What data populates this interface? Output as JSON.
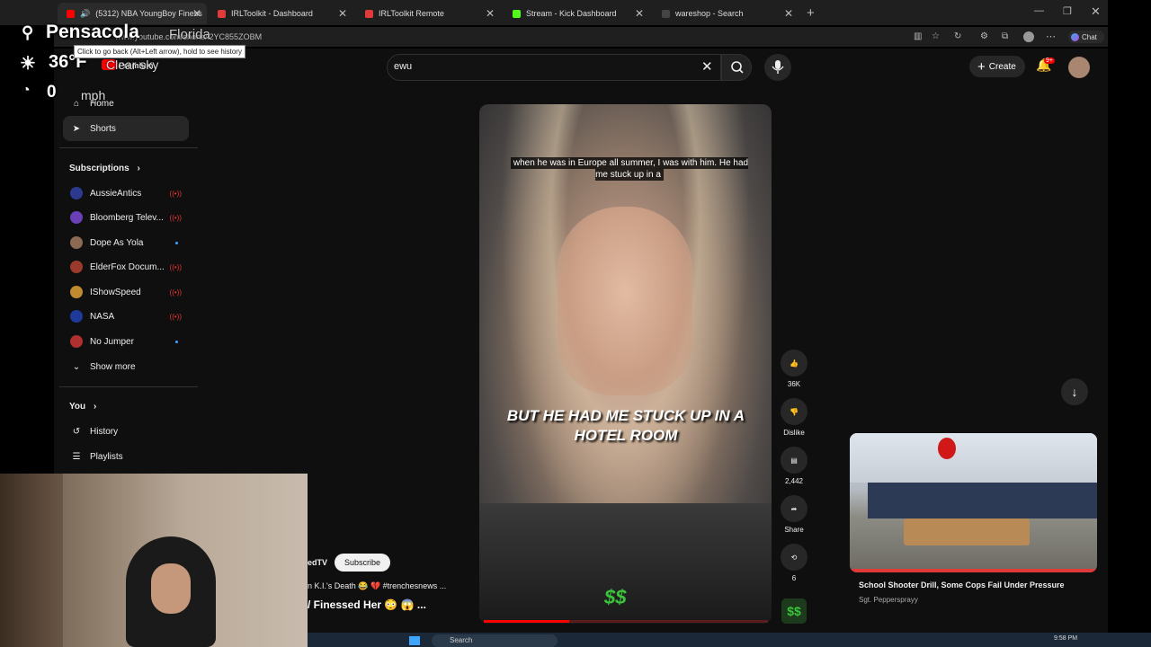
{
  "browser": {
    "tabs": [
      {
        "title": "(5312) NBA YoungBoy Finess",
        "color": "#ff0000"
      },
      {
        "title": "IRLToolkit - Dashboard",
        "color": "#e03a3a"
      },
      {
        "title": "IRLToolkit Remote",
        "color": "#e03a3a"
      },
      {
        "title": "Stream - Kick Dashboard",
        "color": "#53fc18"
      },
      {
        "title": "wareshop - Search",
        "color": "#444444"
      }
    ],
    "url": "www.youtube.com/shorts/l2YC855ZOBM",
    "tooltip": "Click to go back (Alt+Left arrow), hold to see history",
    "chat_label": "Chat"
  },
  "overlay": {
    "city": "Pensacola",
    "state": "Florida",
    "temperature": "36°F",
    "condition": "Clear sky",
    "speed": "0",
    "speed_unit": "mph"
  },
  "youtube": {
    "premium_label": "Premium",
    "search_query": "ewu",
    "create_label": "Create",
    "notifications_badge": "9+",
    "nav": {
      "home": "Home",
      "shorts": "Shorts"
    },
    "subscriptions_label": "Subscriptions",
    "subscriptions": [
      {
        "name": "AussieAntics",
        "status": "live",
        "color": "#2b3a8f"
      },
      {
        "name": "Bloomberg Telev...",
        "status": "live",
        "color": "#6b3fb5"
      },
      {
        "name": "Dope As Yola",
        "status": "new",
        "color": "#8a6a52"
      },
      {
        "name": "ElderFox Docum...",
        "status": "live",
        "color": "#9a3a2a"
      },
      {
        "name": "IShowSpeed",
        "status": "live",
        "color": "#c08a30"
      },
      {
        "name": "NASA",
        "status": "live",
        "color": "#1d3a9a"
      },
      {
        "name": "No Jumper",
        "status": "new",
        "color": "#b03030"
      }
    ],
    "show_more_label": "Show more",
    "you_label": "You",
    "you_items": [
      "History",
      "Playlists"
    ],
    "video": {
      "caption_top": "when he was in Europe all summer, I was with him. He had me stuck up in a",
      "caption_big": "BUT HE HAD ME STUCK UP IN A HOTEL ROOM",
      "progress": 0.3
    },
    "actions": {
      "likes": "36K",
      "dislike_label": "Dislike",
      "comments": "2,442",
      "share_label": "Share",
      "remix_count": "6"
    },
    "left_peek": {
      "channel": "edTV",
      "subscribe_label": "Subscribe",
      "line1": "n K.I.'s Death 😂 💔 #trenchesnews ...",
      "line2": "/ Finessed Her 😳 😱 ..."
    },
    "recommendation": {
      "title": "School Shooter Drill, Some Cops Fail Under Pressure",
      "channel": "Sgt. Peppersprayy"
    }
  },
  "taskbar": {
    "search_label": "Search",
    "time": "9:58 PM"
  }
}
